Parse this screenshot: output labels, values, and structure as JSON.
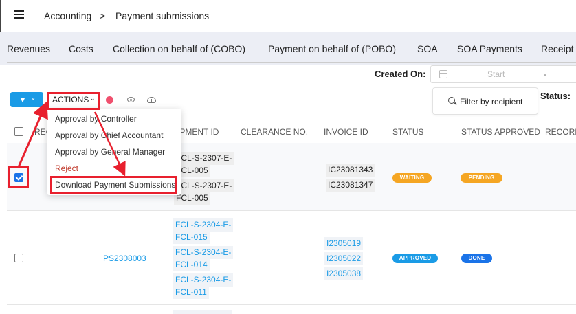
{
  "breadcrumb": {
    "root": "Accounting",
    "separator": ">",
    "current": "Payment submissions"
  },
  "tabs": [
    "Revenues",
    "Costs",
    "Collection on behalf of (COBO)",
    "Payment on behalf of (POBO)",
    "SOA",
    "SOA Payments",
    "Receipt"
  ],
  "filters": {
    "created_on_label": "Created On:",
    "start_placeholder": "Start",
    "date_separator": "-",
    "recipient_button": "Filter by recipient",
    "status_label": "Status:"
  },
  "toolbar": {
    "actions_label": "ACTIONS"
  },
  "actions_menu": [
    "Approval by Controller",
    "Approval by Chief Accountant",
    "Approval by General Manager",
    "Reject",
    "Download Payment Submissions"
  ],
  "table": {
    "headers": [
      "REC",
      "IPMENT ID",
      "CLEARANCE NO.",
      "INVOICE ID",
      "STATUS",
      "STATUS APPROVED",
      "RECORD"
    ],
    "rows": [
      {
        "checked": true,
        "shipment_ids": [
          "FCL-S-2307-E-",
          "FCL-005",
          "FCL-S-2307-E-",
          "FCL-005"
        ],
        "invoice_ids": [
          "IC23081343",
          "IC23081347"
        ],
        "status": "WAITING",
        "status_approved": "PENDING"
      },
      {
        "checked": false,
        "record_id": "PS2308003",
        "shipment_ids": [
          "FCL-S-2304-E-",
          "FCL-015",
          "FCL-S-2304-E-",
          "FCL-014",
          "FCL-S-2304-E-",
          "FCL-011"
        ],
        "invoice_ids": [
          "I2305019",
          "I2305022",
          "I2305038"
        ],
        "status": "APPROVED",
        "status_approved": "DONE"
      }
    ]
  },
  "colors": {
    "accent": "#1a9be6",
    "highlight": "#e8202e",
    "waiting": "#f5a623",
    "done": "#1a73e8"
  }
}
